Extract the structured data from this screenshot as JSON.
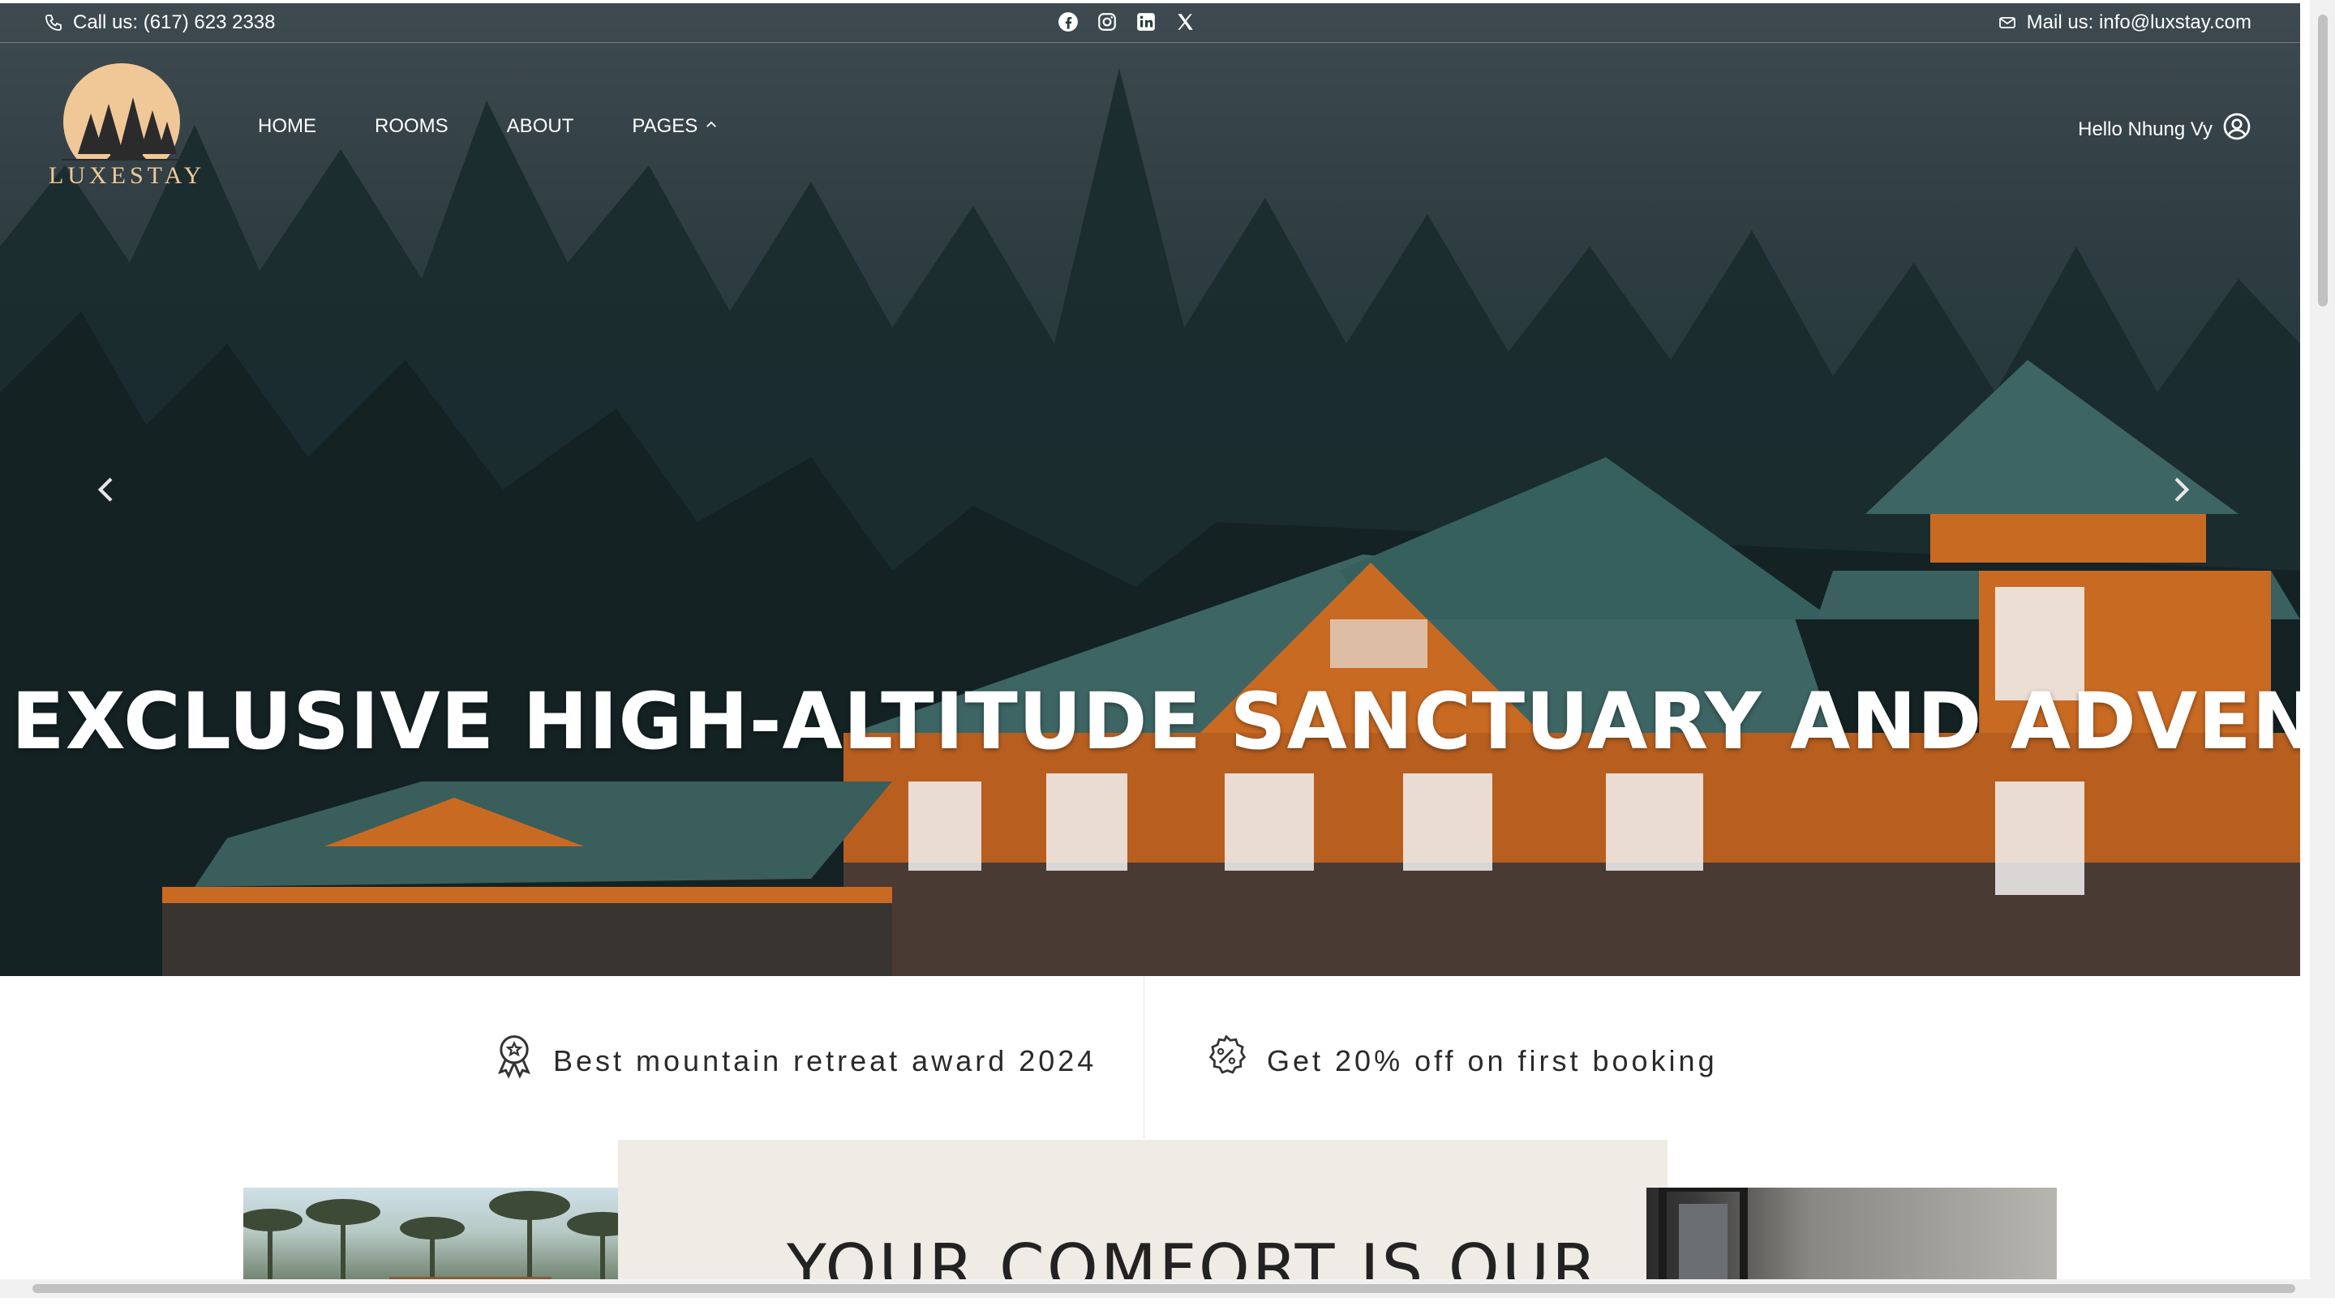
{
  "topbar": {
    "call": "Call us: (617) 623 2338",
    "mail": "Mail us: info@luxstay.com",
    "social_icons": [
      "facebook-icon",
      "instagram-icon",
      "linkedin-icon",
      "x-icon"
    ]
  },
  "brand": {
    "name": "LUXESTAY",
    "accent": "#f0c897"
  },
  "nav": {
    "items": [
      "HOME",
      "ROOMS",
      "ABOUT",
      "PAGES"
    ]
  },
  "user": {
    "greeting": "Hello Nhung Vy"
  },
  "hero": {
    "headline": "EXCLUSIVE HIGH-ALTITUDE SANCTUARY AND ADVENTURE RE"
  },
  "features": {
    "award": "Best mountain retreat award 2024",
    "offer": "Get 20% off on first booking"
  },
  "section": {
    "title": "YOUR COMFORT IS OUR"
  },
  "colors": {
    "roof": "#3d6563",
    "wood": "#c96a23",
    "forest": "#1e3234"
  }
}
